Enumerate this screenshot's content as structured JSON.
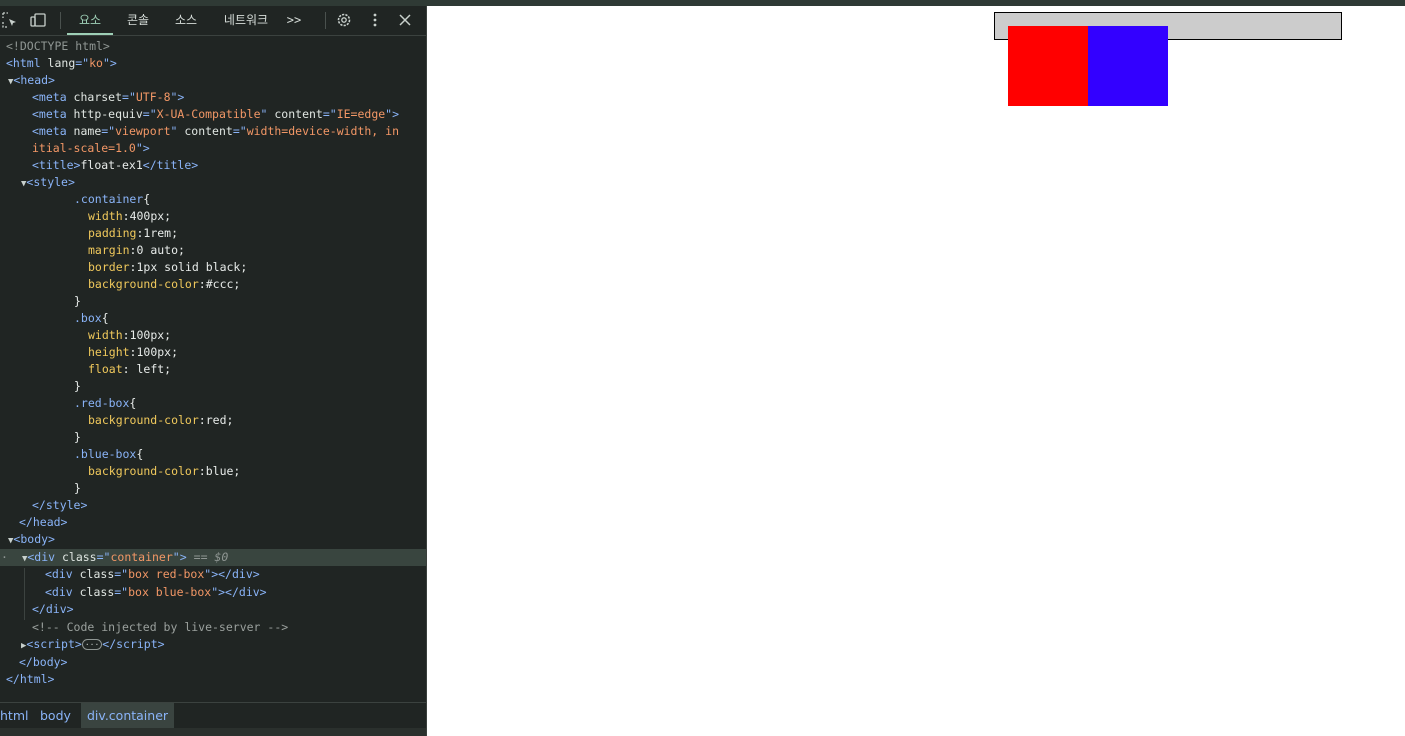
{
  "devtools": {
    "tabs": [
      {
        "label": "요소",
        "active": true
      },
      {
        "label": "콘솔",
        "active": false
      },
      {
        "label": "소스",
        "active": false
      },
      {
        "label": "네트워크",
        "active": false
      }
    ],
    "icons": [
      "inspect-icon",
      "device-toggle-icon",
      "more-tabs-icon",
      "settings-icon",
      "kebab-menu-icon",
      "close-icon"
    ],
    "more_tabs_label": ">>",
    "breadcrumbs": [
      "html",
      "body",
      "div.container"
    ],
    "selected_marker": "== $0",
    "dom": {
      "doctype": "<!DOCTYPE html>",
      "html_lang": "ko",
      "meta_charset": "UTF-8",
      "meta_http_equiv": "X-UA-Compatible",
      "meta_http_content": "IE=edge",
      "meta_viewport_name": "viewport",
      "meta_viewport_content_1": "width=device-width, in",
      "meta_viewport_content_2": "itial-scale=1.0",
      "title": "float-ex1",
      "css": {
        "container_selector": ".container",
        "container_props": [
          {
            "prop": "width",
            "value": "400px;"
          },
          {
            "prop": "padding",
            "value": "1rem;"
          },
          {
            "prop": "margin",
            "value": "0 auto;"
          },
          {
            "prop": "border",
            "value": "1px solid black;"
          },
          {
            "prop": "background-color",
            "value": "#ccc;"
          }
        ],
        "box_selector": ".box",
        "box_props": [
          {
            "prop": "width",
            "value": "100px;"
          },
          {
            "prop": "height",
            "value": "100px;"
          },
          {
            "prop": "float",
            "value": " left;"
          }
        ],
        "red_selector": ".red-box",
        "red_props": [
          {
            "prop": "background-color",
            "value": "red;"
          }
        ],
        "blue_selector": ".blue-box",
        "blue_props": [
          {
            "prop": "background-color",
            "value": "blue;"
          }
        ]
      },
      "div_container_class": "container",
      "red_div_class": "box red-box",
      "blue_div_class": "box blue-box",
      "comment": "<!-- Code injected by live-server -->"
    }
  },
  "page": {
    "container_bg": "#cccccc",
    "red_color": "#ff0000",
    "blue_color": "#3300ff"
  }
}
